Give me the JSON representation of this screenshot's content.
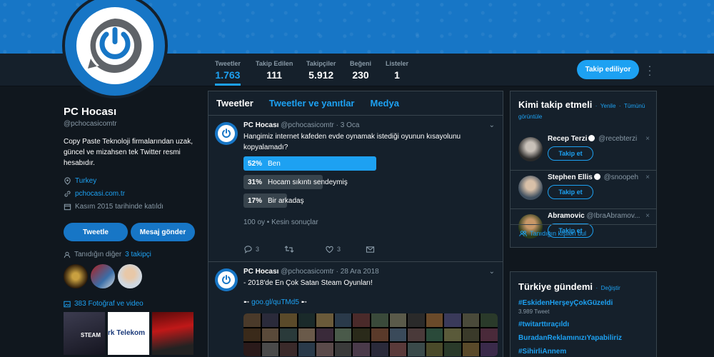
{
  "header": {
    "stats": [
      {
        "label": "Tweetler",
        "value": "1.763",
        "active": true
      },
      {
        "label": "Takip Edilen",
        "value": "111",
        "active": false
      },
      {
        "label": "Takipçiler",
        "value": "5.912",
        "active": false
      },
      {
        "label": "Beğeni",
        "value": "230",
        "active": false
      },
      {
        "label": "Listeler",
        "value": "1",
        "active": false
      }
    ],
    "follow_label": "Takip ediliyor",
    "more_icon": "more-vertical-icon"
  },
  "profile": {
    "name": "PC Hocası",
    "handle": "@pchocasicomtr",
    "bio": "Copy Paste Teknoloji firmalarından uzak, güncel ve mizahsen tek Twitter resmi hesabıdır.",
    "location": "Turkey",
    "website": "pchocasi.com.tr",
    "joined": "Kasım 2015 tarihinde katıldı",
    "tweet_button": "Tweetle",
    "message_button": "Mesaj gönder",
    "known_followers_prefix": "Tanıdığın diğer",
    "known_followers_link": "3 takipçi",
    "media_link": "383 Fotoğraf ve video",
    "media_thumb_text": "rk Telekom",
    "media_thumb_text2": "STEAM"
  },
  "timeline": {
    "tabs": [
      "Tweetler",
      "Tweetler ve yanıtlar",
      "Medya"
    ],
    "tweets": [
      {
        "name": "PC Hocası",
        "handle": "@pchocasicomtr",
        "date": "3 Oca",
        "text": "Hangimiz internet kafeden evde oynamak istediği oyunun kısayolunu kopyalamadı?",
        "poll": [
          {
            "pct": "52%",
            "label": "Ben",
            "value": 52,
            "winner": true
          },
          {
            "pct": "31%",
            "label": "Hocam sıkıntı sendeymiş",
            "value": 31,
            "winner": false
          },
          {
            "pct": "17%",
            "label": "Bir arkadaş",
            "value": 17,
            "winner": false
          }
        ],
        "poll_meta": "100 oy • Kesin sonuçlar",
        "replies": "3",
        "retweets": "",
        "likes": "3"
      },
      {
        "name": "PC Hocası",
        "handle": "@pchocasicomtr",
        "date": "28 Ara 2018",
        "text": "- 2018'de En Çok Satan Steam Oyunları!",
        "link_prefix": "➸",
        "link": "goo.gl/quTMd5",
        "link_suffix": "➸"
      }
    ]
  },
  "who_to_follow": {
    "title": "Kimi takip etmeli",
    "refresh": "Yenile",
    "view_all": "Tümünü görüntüle",
    "users": [
      {
        "name": "Recep Terzi",
        "handle": "@recebterzi",
        "verified": true
      },
      {
        "name": "Stephen Ellis",
        "handle": "@snoopeh",
        "verified": true
      },
      {
        "name": "Abramovic",
        "handle": "@IbraAbramov...",
        "verified": false
      }
    ],
    "follow_label": "Takip et",
    "find_people": "Tanıdığın kişileri bul"
  },
  "trends": {
    "title": "Türkiye gündemi",
    "change": "Değiştir",
    "items": [
      {
        "tag": "#EskidenHerşeyÇokGüzeldi",
        "count": "3.989 Tweet"
      },
      {
        "tag": "#twitarttıraçıldı",
        "count": ""
      },
      {
        "tag": "BuradanReklamınızıYapabiliriz",
        "count": ""
      },
      {
        "tag": "#SihirliAnnem",
        "count": ""
      }
    ]
  },
  "colors": {
    "accent": "#1da1f2",
    "background": "#10171e",
    "panel": "#15202b",
    "banner": "#1776c6"
  }
}
